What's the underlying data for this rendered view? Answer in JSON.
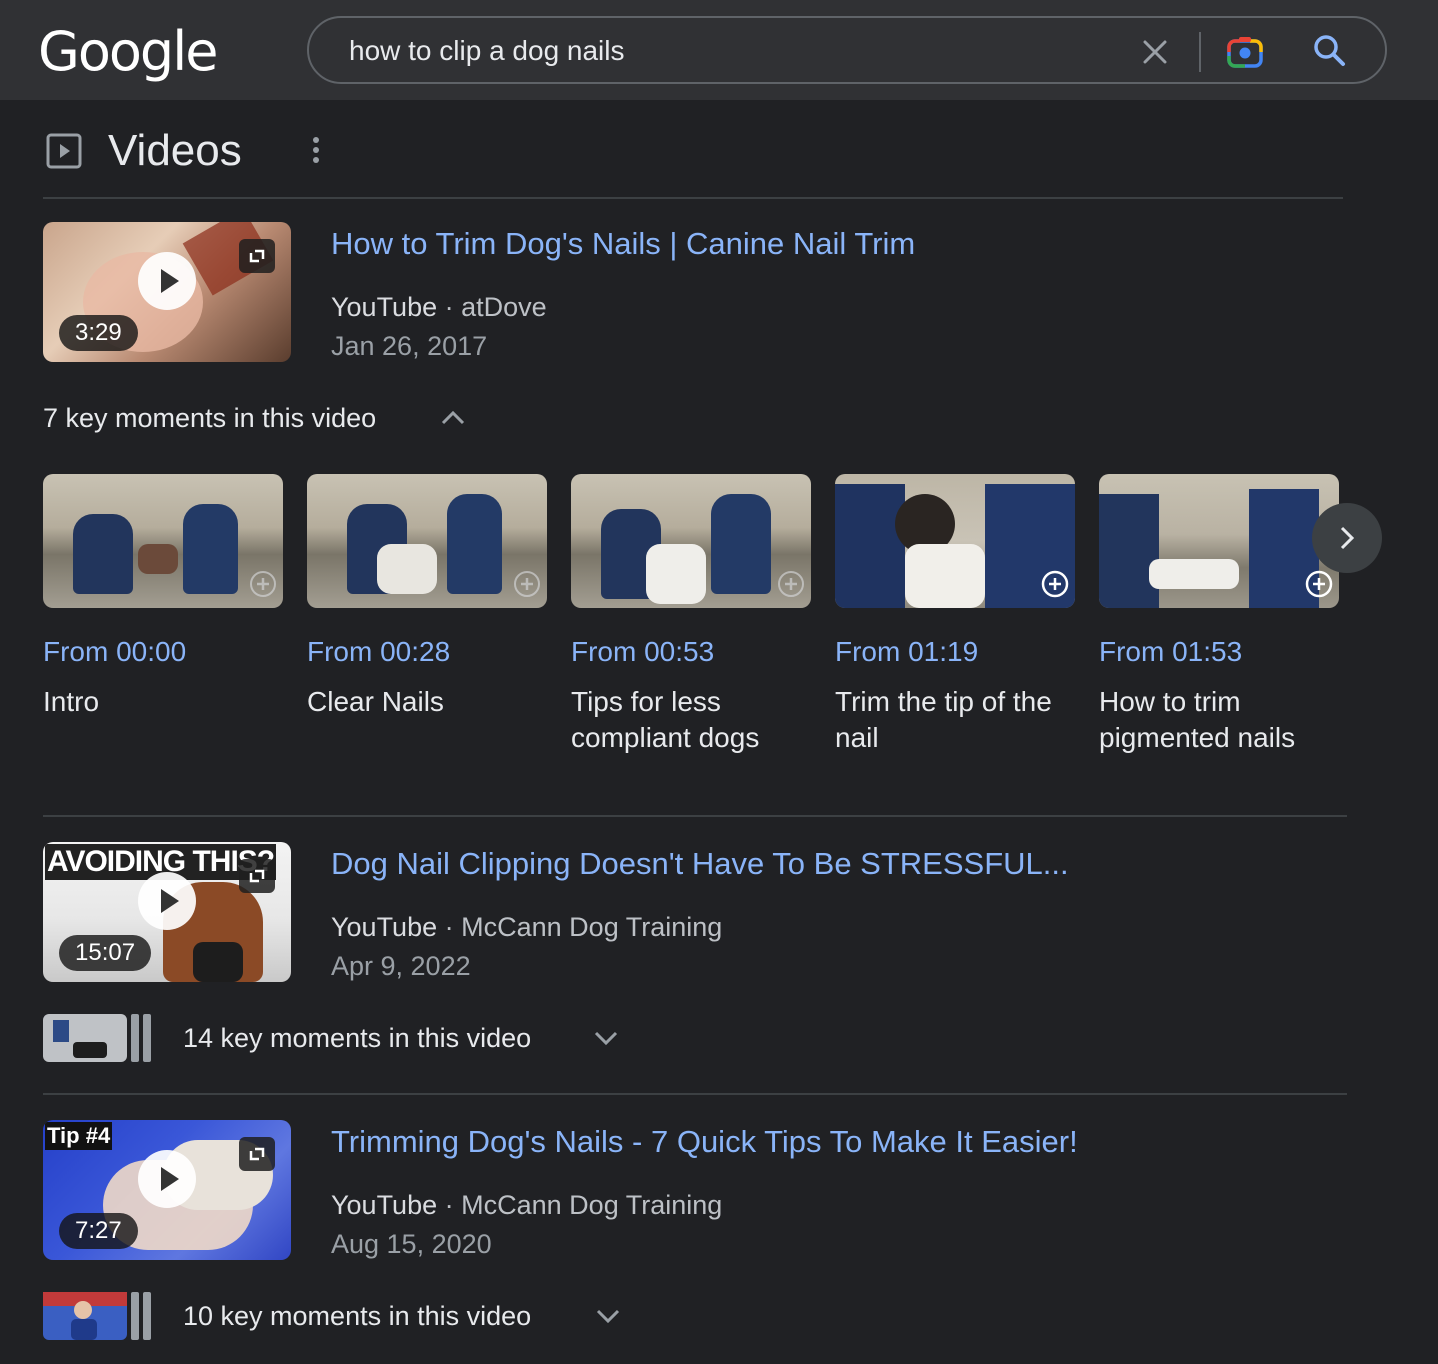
{
  "header": {
    "logo": "Google",
    "query": "how to clip a dog nails"
  },
  "section": {
    "title": "Videos"
  },
  "results": [
    {
      "title": "How to Trim Dog's Nails | Canine Nail Trim",
      "site": "YouTube",
      "channel": "atDove",
      "date": "Jan 26, 2017",
      "duration": "3:29",
      "key_moments_label": "7 key moments in this video",
      "expanded": true
    },
    {
      "title": "Dog Nail Clipping Doesn't Have To Be STRESSFUL...",
      "site": "YouTube",
      "channel": "McCann Dog Training",
      "date": "Apr 9, 2022",
      "duration": "15:07",
      "thumb_text": "AVOIDING THIS?",
      "key_moments_label": "14 key moments in this video",
      "expanded": false
    },
    {
      "title": "Trimming Dog's Nails - 7 Quick Tips To Make It Easier!",
      "site": "YouTube",
      "channel": "McCann Dog Training",
      "date": "Aug 15, 2020",
      "duration": "7:27",
      "thumb_text": "Tip #4",
      "key_moments_label": "10 key moments in this video",
      "expanded": false
    }
  ],
  "key_moments": [
    {
      "from": "From 00:00",
      "label": "Intro"
    },
    {
      "from": "From 00:28",
      "label": "Clear Nails"
    },
    {
      "from": "From 00:53",
      "label": "Tips for less compliant dogs"
    },
    {
      "from": "From 01:19",
      "label": "Trim the tip of the nail"
    },
    {
      "from": "From 01:53",
      "label": "How to trim pigmented nails"
    }
  ],
  "separator": "·",
  "colors": {
    "background": "#202124",
    "header": "#303134",
    "link": "#8ab4f8",
    "text": "#e8eaed",
    "secondary": "#9aa0a6"
  }
}
